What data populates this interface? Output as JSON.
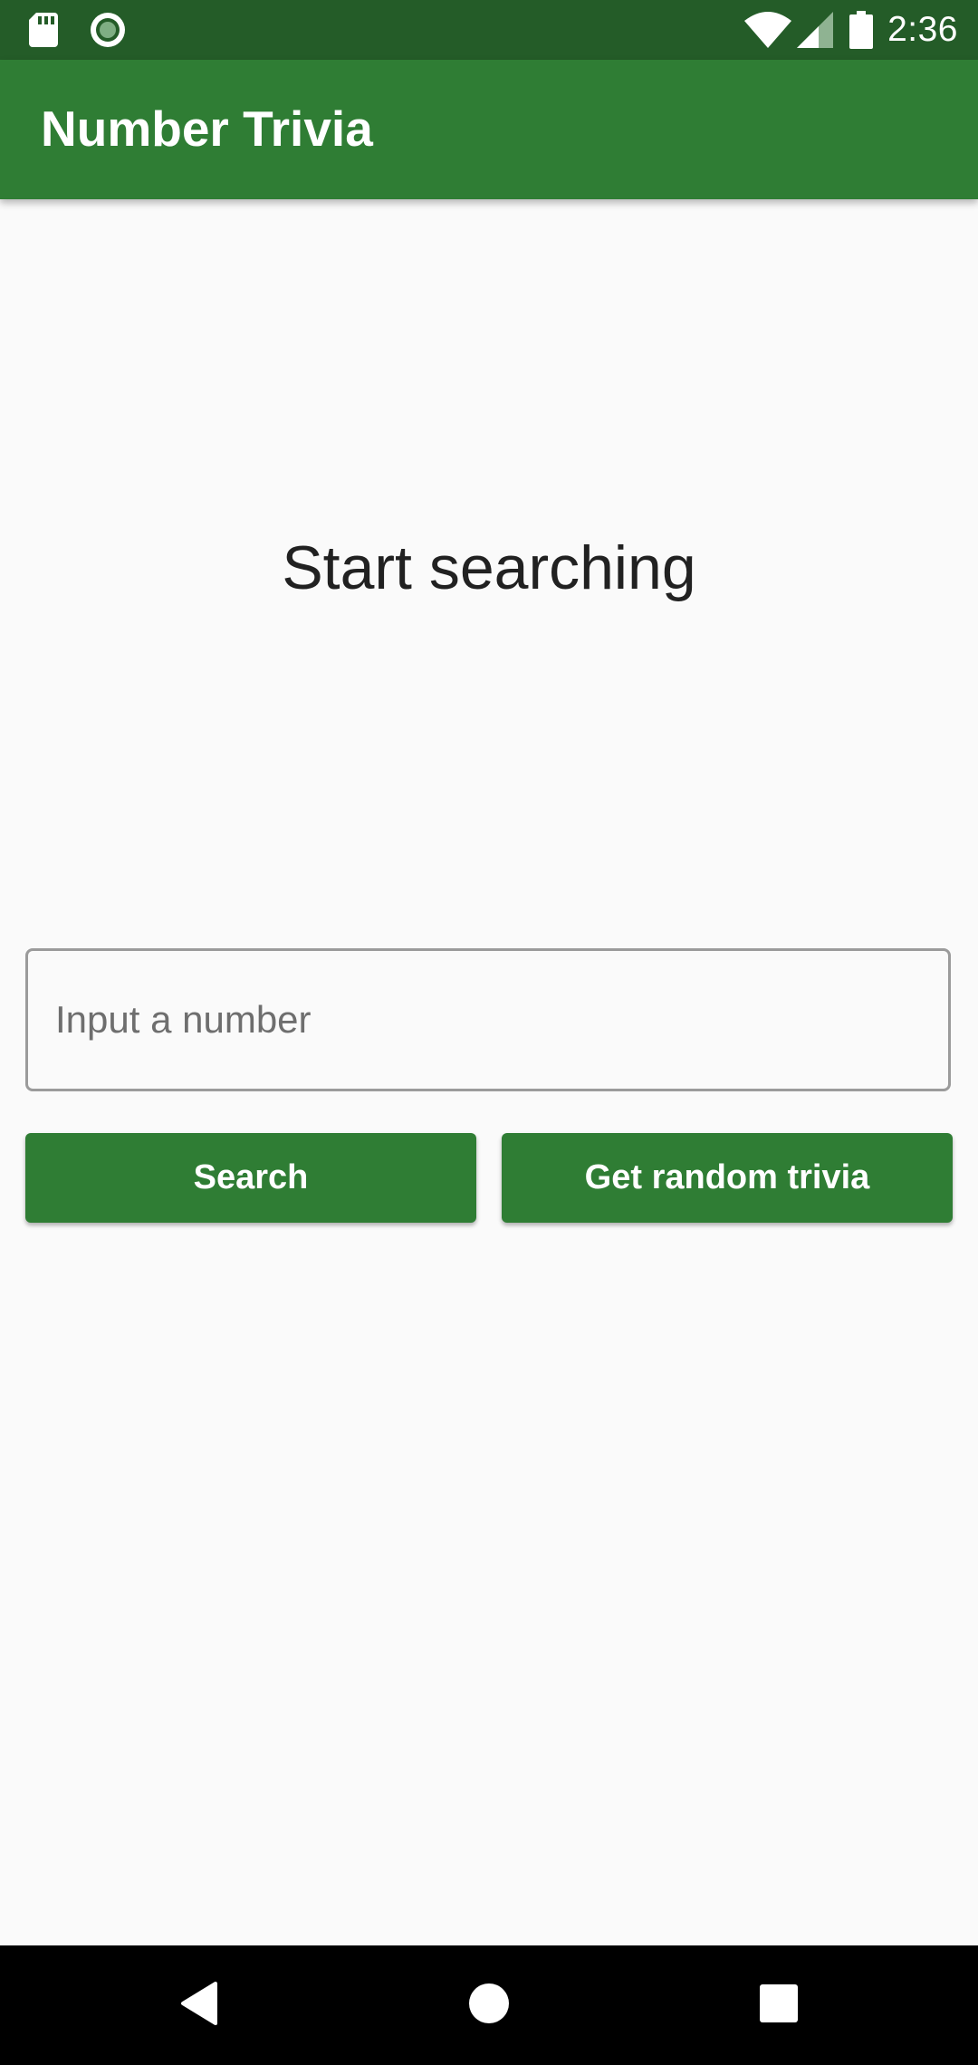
{
  "status_bar": {
    "time": "2:36",
    "icons": [
      "sdcard-icon",
      "record-icon",
      "wifi-icon",
      "signal-icon",
      "battery-icon"
    ]
  },
  "app_bar": {
    "title": "Number Trivia"
  },
  "main": {
    "message": "Start searching",
    "number_input": {
      "placeholder": "Input a number",
      "value": ""
    },
    "search_button_label": "Search",
    "random_button_label": "Get random trivia"
  },
  "nav_bar": {
    "icons": [
      "back-icon",
      "home-icon",
      "recents-icon"
    ]
  },
  "colors": {
    "primary": "#2f7d34",
    "primary_dark": "#245c28",
    "background": "#fafafa",
    "text": "#212121"
  }
}
